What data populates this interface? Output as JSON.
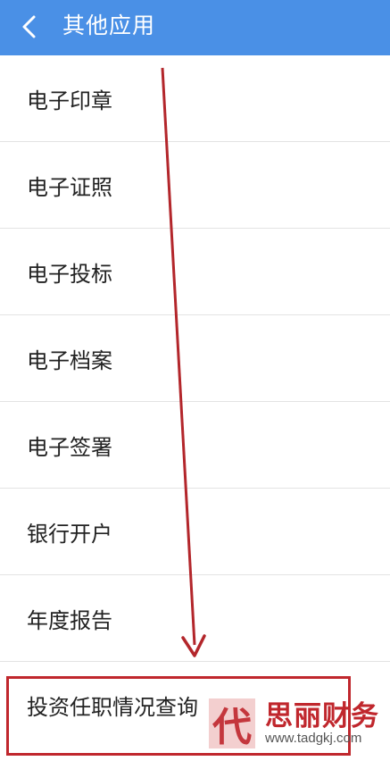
{
  "header": {
    "title": "其他应用",
    "back_icon": "chevron-left-icon",
    "background": "#4a90e6"
  },
  "list": {
    "items": [
      {
        "label": "电子印章"
      },
      {
        "label": "电子证照"
      },
      {
        "label": "电子投标"
      },
      {
        "label": "电子档案"
      },
      {
        "label": "电子签署"
      },
      {
        "label": "银行开户"
      },
      {
        "label": "年度报告"
      },
      {
        "label": "投资任职情况查询"
      }
    ]
  },
  "annotation": {
    "arrow_icon": "down-arrow-icon",
    "color": "#c0272d",
    "highlighted_item": "投资任职情况查询"
  },
  "watermark": {
    "stamp_char": "代",
    "name": "思丽财务",
    "url": "www.tadgkj.com"
  }
}
